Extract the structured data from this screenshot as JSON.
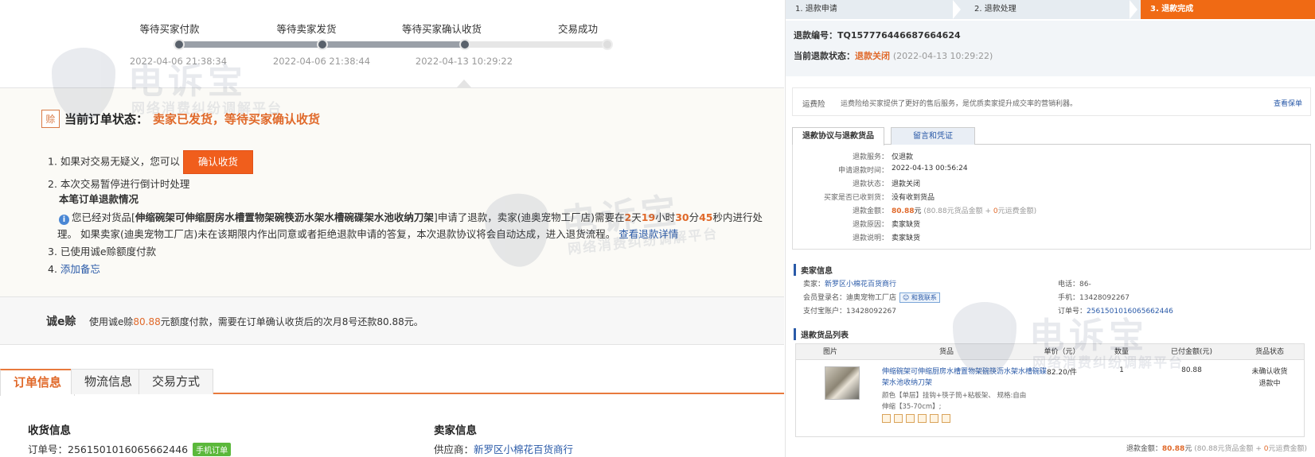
{
  "progress": {
    "steps": [
      {
        "label": "等待买家付款",
        "time": "2022-04-06 21:38:34"
      },
      {
        "label": "等待卖家发货",
        "time": "2022-04-06 21:38:44"
      },
      {
        "label": "等待买家确认收货",
        "time": "2022-04-13 10:29:22"
      },
      {
        "label": "交易成功",
        "time": ""
      }
    ]
  },
  "status": {
    "icon_text": "赊",
    "title": "当前订单状态：",
    "value": "卖家已发货，等待买家确认收货",
    "item1_text": "1. 如果对交易无疑义，您可以",
    "confirm_button": "确认收货",
    "item2_text": "2. 本次交易暂停进行倒计时处理",
    "refund_title": "本笔订单退款情况",
    "refund_prefix": "您已经对货品[",
    "product_name": "伸缩碗架可伸缩厨房水槽置物架碗筷沥水架水槽碗碟架水池收纳刀架",
    "refund_mid": "]申请了退款，卖家(迪奥宠物工厂店)需要在",
    "days": "2",
    "days_unit": "天",
    "hours": "19",
    "hours_unit": "小时",
    "minutes": "30",
    "minutes_unit": "分",
    "seconds": "45",
    "seconds_unit": "秒内进行处",
    "refund_line2": "理。 如果卖家(迪奥宠物工厂店)未在该期限内作出同意或者拒绝退款申请的答复，本次退款协议将会自动达成，进入退货流程。",
    "refund_link": "查看退款详情",
    "item3_text": "3. 已使用诚e赊额度付款",
    "item4_prefix": "4. ",
    "item4_link": "添加备忘"
  },
  "credit": {
    "title": "诚e赊",
    "text_prefix": "使用诚e赊",
    "amount": "80.88",
    "text_suffix": "元额度付款，需要在订单确认收货后的次月8号还款80.88元。"
  },
  "tabs": [
    "订单信息",
    "物流信息",
    "交易方式"
  ],
  "receive": {
    "heading": "收货信息",
    "order_label": "订单号：",
    "order_no": "2561501016065662446",
    "badge": "手机订单"
  },
  "seller_left": {
    "heading": "卖家信息",
    "supplier_label": "供应商：",
    "supplier": "新罗区小棉花百货商行"
  },
  "refund_steps": [
    "1. 退款申请",
    "2. 退款处理",
    "3. 退款完成"
  ],
  "refund_head": {
    "no_label": "退款编号：",
    "no": "TQ157776446687664624",
    "state_label": "当前退款状态：",
    "state": "退款关闭",
    "state_time": "(2022-04-13 10:29:22)"
  },
  "insurance": {
    "title": "运费险",
    "desc": "运费险给买家提供了更好的售后服务，是优质卖家提升成交率的营销利器。",
    "link": "查看保单"
  },
  "refund_tabs": [
    "退款协议与退款货品",
    "留言和凭证"
  ],
  "detail": {
    "rows": [
      {
        "k": "退款服务：",
        "v": "仅退款"
      },
      {
        "k": "申请退款时间：",
        "v": "2022-04-13 00:56:24"
      },
      {
        "k": "退款状态：",
        "v": "退款关闭"
      },
      {
        "k": "买家是否已收到货：",
        "v": "没有收到货品"
      },
      {
        "k": "退款金额：",
        "v": ""
      },
      {
        "k": "退款原因：",
        "v": "卖家缺货"
      },
      {
        "k": "退款说明：",
        "v": "卖家缺货"
      }
    ],
    "amount": "80.88",
    "amount_unit": "元",
    "amount_breakdown_pre": "(80.88元货品金额 + ",
    "amount_breakdown_zero": "0",
    "amount_breakdown_post": "元运费金额)"
  },
  "seller_right": {
    "heading": "卖家信息",
    "seller_label": "卖家：",
    "seller": "新罗区小棉花百货商行",
    "member_label": "会员登录名：",
    "member": "迪奥宠物工厂店",
    "contact": "和我联系",
    "alipay_label": "支付宝账户：",
    "alipay": "13428092267",
    "phone_label": "电话：",
    "phone": "86-",
    "mobile_label": "手机：",
    "mobile": "13428092267",
    "order_label": "订单号：",
    "order": "2561501016065662446"
  },
  "goods": {
    "heading": "退款货品列表",
    "cols": [
      "图片",
      "货品",
      "单价（元）",
      "数量",
      "已付金额(元)",
      "货品状态"
    ],
    "name": "伸缩碗架可伸缩厨房水槽置物架碗筷沥水架水槽碗碟架水池收纳刀架",
    "attr1": "颜色【单层】挂钩+筷子筒+粘板架、  规格:自由",
    "attr2": "伸缩【35-70cm】;",
    "price": "82.20/件",
    "qty": "1",
    "paid": "80.88",
    "status1": "未确认收货",
    "status2": "退款中"
  },
  "total": {
    "label": "退款金额：",
    "amount": "80.88",
    "unit": "元",
    "pre": "(80.88元货品金额 + ",
    "zero": "0",
    "post": "元运费金额)"
  },
  "watermark": {
    "big": "电诉宝",
    "small": "网络消费纠纷调解平台"
  },
  "colors": {
    "accent_orange": "#f05e1c",
    "link_blue": "#2a5aa8",
    "status_orange": "#e0692a"
  }
}
